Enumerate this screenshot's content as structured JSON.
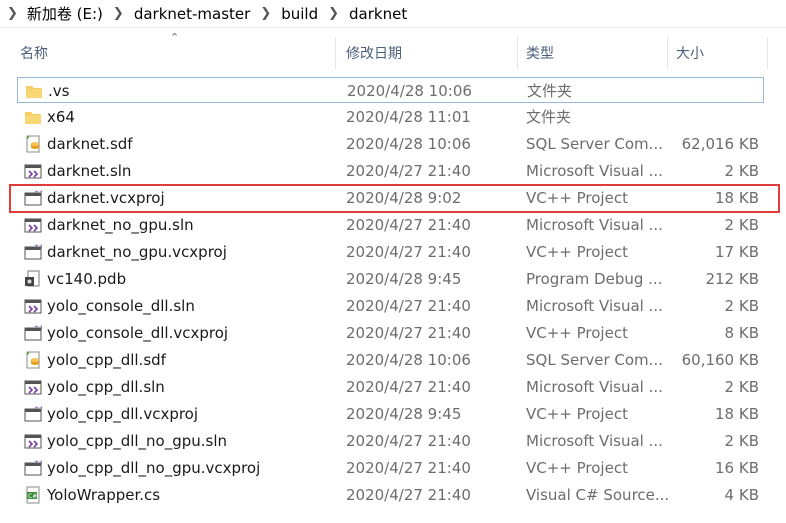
{
  "breadcrumb": [
    "新加卷 (E:)",
    "darknet-master",
    "build",
    "darknet"
  ],
  "columns": {
    "name": "名称",
    "date": "修改日期",
    "type": "类型",
    "size": "大小"
  },
  "files": [
    {
      "name": ".vs",
      "date": "2020/4/28 10:06",
      "type": "文件夹",
      "size": "",
      "icon": "folder-icon"
    },
    {
      "name": "x64",
      "date": "2020/4/28 11:01",
      "type": "文件夹",
      "size": "",
      "icon": "folder-icon"
    },
    {
      "name": "darknet.sdf",
      "date": "2020/4/28 10:06",
      "type": "SQL Server Com...",
      "size": "62,016 KB",
      "icon": "sdf-file-icon"
    },
    {
      "name": "darknet.sln",
      "date": "2020/4/27 21:40",
      "type": "Microsoft Visual ...",
      "size": "2 KB",
      "icon": "sln-file-icon"
    },
    {
      "name": "darknet.vcxproj",
      "date": "2020/4/28 9:02",
      "type": "VC++ Project",
      "size": "18 KB",
      "icon": "vcxproj-file-icon"
    },
    {
      "name": "darknet_no_gpu.sln",
      "date": "2020/4/27 21:40",
      "type": "Microsoft Visual ...",
      "size": "2 KB",
      "icon": "sln-file-icon"
    },
    {
      "name": "darknet_no_gpu.vcxproj",
      "date": "2020/4/27 21:40",
      "type": "VC++ Project",
      "size": "17 KB",
      "icon": "vcxproj-file-icon"
    },
    {
      "name": "vc140.pdb",
      "date": "2020/4/28 9:45",
      "type": "Program Debug ...",
      "size": "212 KB",
      "icon": "pdb-file-icon"
    },
    {
      "name": "yolo_console_dll.sln",
      "date": "2020/4/27 21:40",
      "type": "Microsoft Visual ...",
      "size": "2 KB",
      "icon": "sln-file-icon"
    },
    {
      "name": "yolo_console_dll.vcxproj",
      "date": "2020/4/27 21:40",
      "type": "VC++ Project",
      "size": "8 KB",
      "icon": "vcxproj-file-icon"
    },
    {
      "name": "yolo_cpp_dll.sdf",
      "date": "2020/4/28 10:06",
      "type": "SQL Server Com...",
      "size": "60,160 KB",
      "icon": "sdf-file-icon"
    },
    {
      "name": "yolo_cpp_dll.sln",
      "date": "2020/4/27 21:40",
      "type": "Microsoft Visual ...",
      "size": "2 KB",
      "icon": "sln-file-icon"
    },
    {
      "name": "yolo_cpp_dll.vcxproj",
      "date": "2020/4/28 9:45",
      "type": "VC++ Project",
      "size": "18 KB",
      "icon": "vcxproj-file-icon"
    },
    {
      "name": "yolo_cpp_dll_no_gpu.sln",
      "date": "2020/4/27 21:40",
      "type": "Microsoft Visual ...",
      "size": "2 KB",
      "icon": "sln-file-icon"
    },
    {
      "name": "yolo_cpp_dll_no_gpu.vcxproj",
      "date": "2020/4/27 21:40",
      "type": "VC++ Project",
      "size": "16 KB",
      "icon": "vcxproj-file-icon"
    },
    {
      "name": "YoloWrapper.cs",
      "date": "2020/4/27 21:40",
      "type": "Visual C# Source...",
      "size": "4 KB",
      "icon": "cs-file-icon"
    }
  ],
  "colors": {
    "highlight": "#e03c3c",
    "focus_border": "#99b9d8",
    "header_text": "#4c607a"
  }
}
